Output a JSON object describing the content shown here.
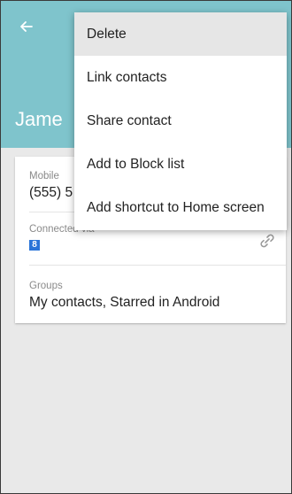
{
  "header": {
    "back_icon": "arrow-left-icon",
    "contact_name": "Jame"
  },
  "card": {
    "mobile": {
      "label": "Mobile",
      "value": "(555) 5"
    },
    "connected": {
      "label": "Connected via",
      "icon": "link-icon",
      "badge": "8"
    },
    "groups": {
      "label": "Groups",
      "value": "My contacts, Starred in Android"
    }
  },
  "menu": {
    "items": [
      {
        "label": "Delete",
        "active": true
      },
      {
        "label": "Link contacts"
      },
      {
        "label": "Share contact"
      },
      {
        "label": "Add to Block list"
      },
      {
        "label": "Add shortcut to Home screen"
      }
    ]
  }
}
